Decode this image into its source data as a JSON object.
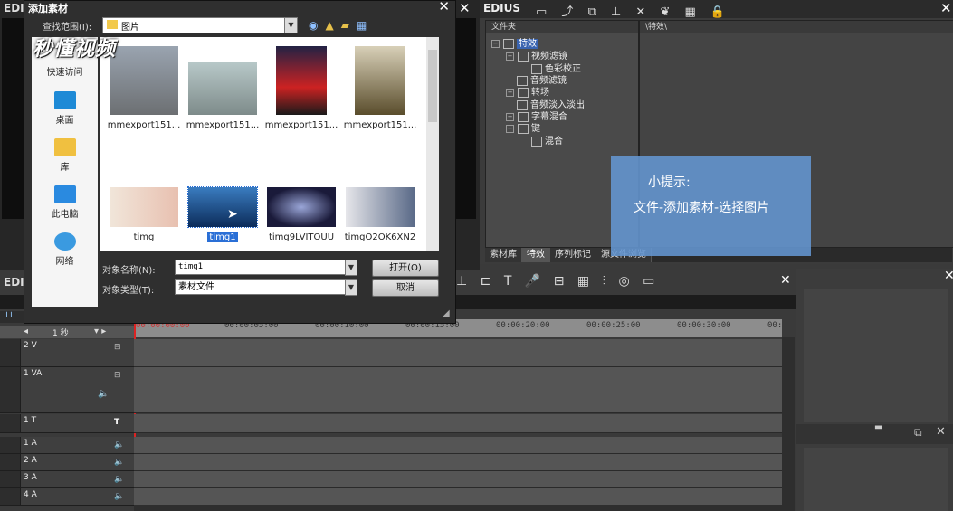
{
  "left_window": {
    "title": "EDI",
    "close": "✕"
  },
  "dialog": {
    "title": "添加素材",
    "close": "✕",
    "lookin_label": "查找范围(I):",
    "lookin_value": "图片",
    "places": [
      "快速访问",
      "桌面",
      "库",
      "此电脑",
      "网络"
    ],
    "files": [
      {
        "name": "mmexport151...",
        "selected": false
      },
      {
        "name": "mmexport151...",
        "selected": false
      },
      {
        "name": "mmexport151...",
        "selected": false
      },
      {
        "name": "mmexport151...",
        "selected": false
      },
      {
        "name": "timg",
        "selected": false
      },
      {
        "name": "timg1",
        "selected": true
      },
      {
        "name": "timg9LVITOUU",
        "selected": false
      },
      {
        "name": "timgO2OK6XN2",
        "selected": false
      }
    ],
    "name_label": "对象名称(N):",
    "name_value": "timg1",
    "type_label": "对象类型(T):",
    "type_value": "素材文件",
    "open_button": "打开(O)",
    "cancel_button": "取消"
  },
  "watermark": {
    "text": "秒懂视频"
  },
  "right_window": {
    "title": "EDIUS",
    "close": "✕",
    "tree_header": "文件夹",
    "content_header": "\\特效\\",
    "tree": [
      {
        "label": "特效",
        "selected": true
      },
      {
        "label": "视频滤镜"
      },
      {
        "label": "色彩校正"
      },
      {
        "label": "音频滤镜"
      },
      {
        "label": "转场"
      },
      {
        "label": "音频淡入淡出"
      },
      {
        "label": "字幕混合"
      },
      {
        "label": "键"
      },
      {
        "label": "混合"
      }
    ],
    "tabs": [
      "素材库",
      "特效",
      "序列标记",
      "源文件浏览"
    ]
  },
  "tip": {
    "line1": "小提示:",
    "line2": "文件-添加素材-选择图片"
  },
  "timeline": {
    "title": "EDI",
    "close": "✕",
    "scale": "1 秒",
    "ruler": [
      "00:00:00:00",
      "00:00:05:00",
      "00:00:10:00",
      "00:00:15:00",
      "00:00:20:00",
      "00:00:25:00",
      "00:00:30:00",
      "00:"
    ],
    "tracks": [
      {
        "name": "2 V"
      },
      {
        "name": "1 VA"
      },
      {
        "name": "1 T"
      },
      {
        "name": "1 A"
      },
      {
        "name": "2 A"
      },
      {
        "name": "3 A"
      },
      {
        "name": "4 A"
      }
    ]
  },
  "far_right": {
    "close": "✕"
  }
}
